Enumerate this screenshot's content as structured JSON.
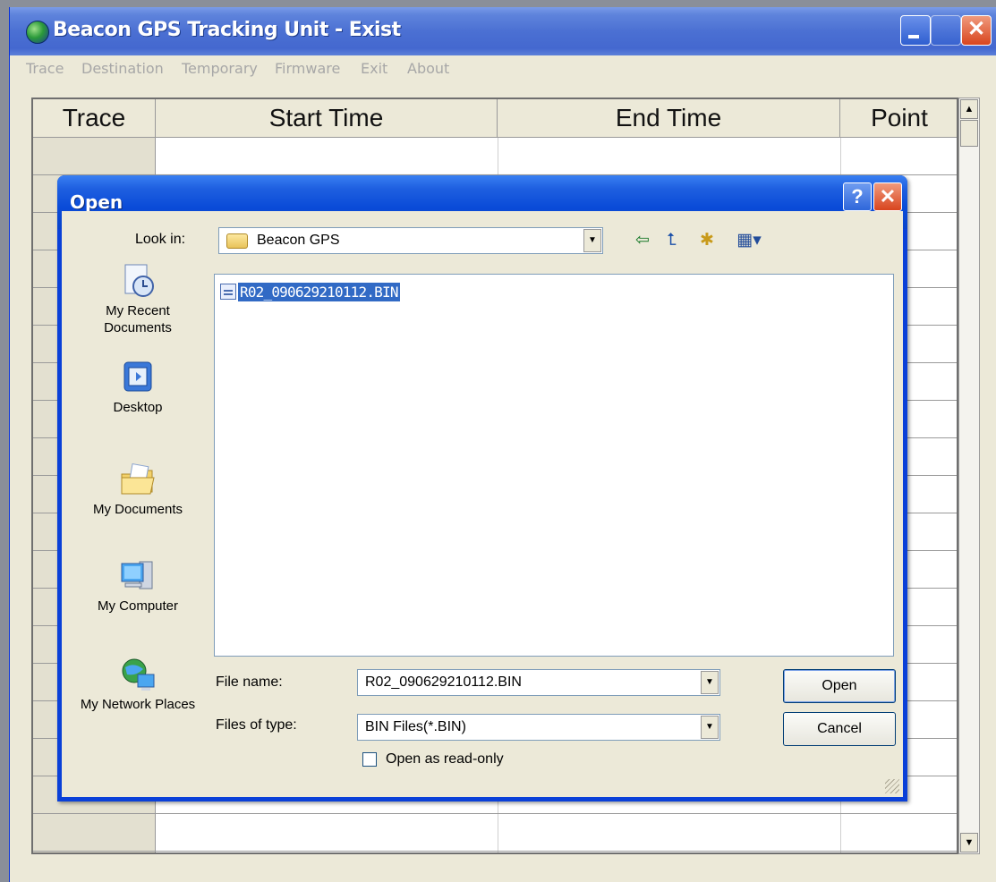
{
  "window": {
    "title": "Beacon GPS Tracking Unit - Exist"
  },
  "menu": [
    "Trace",
    "Destination",
    "Temporary",
    "Firmware",
    "Exit",
    "About"
  ],
  "grid": {
    "columns": [
      "Trace",
      "Start Time",
      "End Time",
      "Point"
    ]
  },
  "dialog": {
    "title": "Open",
    "help_glyph": "?",
    "close_glyph": "✕",
    "look_in_label": "Look in:",
    "look_in_value": "Beacon GPS",
    "places": [
      {
        "label": "My Recent Documents",
        "icon": "recent-documents-icon"
      },
      {
        "label": "Desktop",
        "icon": "desktop-icon"
      },
      {
        "label": "My Documents",
        "icon": "my-documents-icon"
      },
      {
        "label": "My Computer",
        "icon": "my-computer-icon"
      },
      {
        "label": "My Network Places",
        "icon": "network-places-icon"
      }
    ],
    "files": [
      "R02_090629210112.BIN"
    ],
    "file_name_label": "File name:",
    "file_name_value": "R02_090629210112.BIN",
    "file_type_label": "Files of type:",
    "file_type_value": "BIN Files(*.BIN)",
    "readonly_label": "Open as read-only",
    "open_label": "Open",
    "cancel_label": "Cancel"
  }
}
